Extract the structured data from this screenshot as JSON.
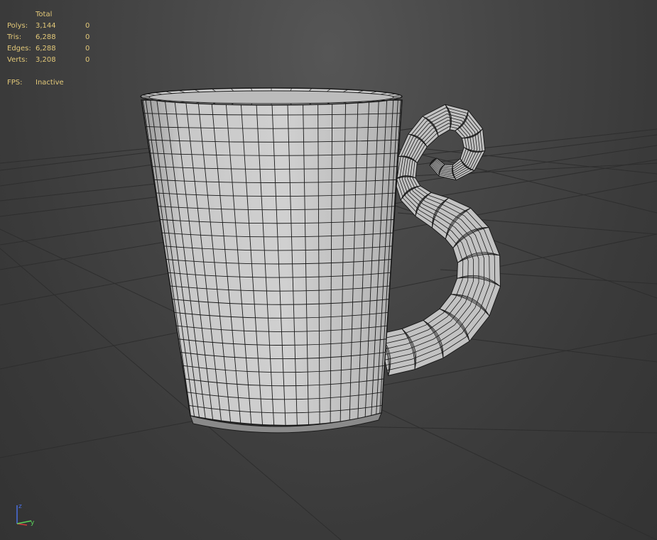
{
  "viewport": {
    "background_color": "#474747",
    "grid_color": "#2a2a2a",
    "mesh_fill": "#c4c4c4",
    "mesh_wire": "#1a1a1a",
    "object": "mug"
  },
  "stats": {
    "header": "Total",
    "rows": [
      {
        "label": "Polys:",
        "total": "3,144",
        "selected": "0"
      },
      {
        "label": "Tris:",
        "total": "6,288",
        "selected": "0"
      },
      {
        "label": "Edges:",
        "total": "6,288",
        "selected": "0"
      },
      {
        "label": "Verts:",
        "total": "3,208",
        "selected": "0"
      }
    ],
    "fps_label": "FPS:",
    "fps_value": "Inactive",
    "text_color": "#e2c878"
  },
  "axis_gizmo": {
    "z_label": "z",
    "y_label": "y",
    "colors": {
      "x": "#d23a3a",
      "y": "#5bd35b",
      "z": "#4a6fe0"
    }
  }
}
